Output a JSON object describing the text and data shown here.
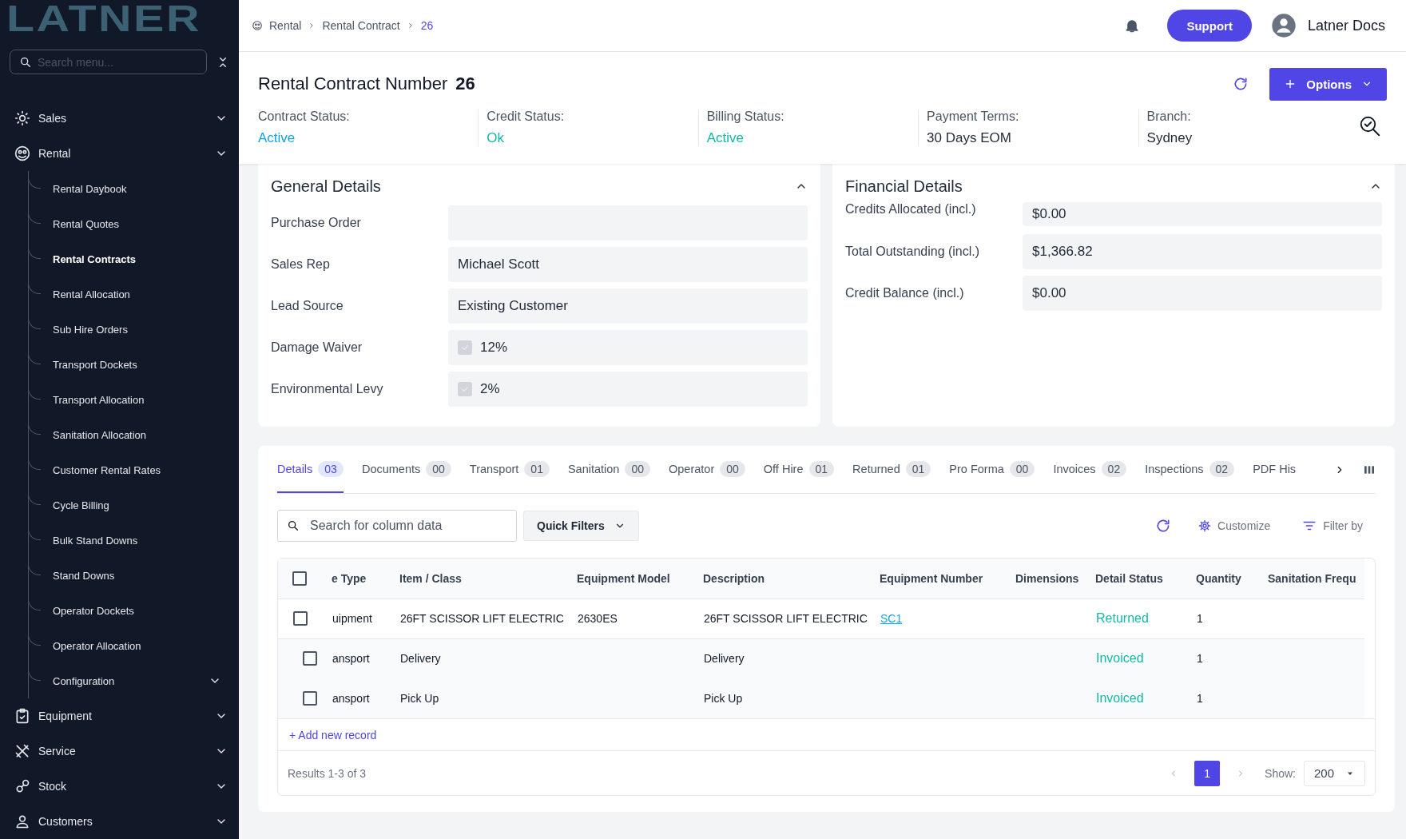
{
  "sidebar": {
    "logo": "LATNER",
    "search": {
      "placeholder": "Search menu..."
    },
    "items": [
      {
        "label": "Sales"
      },
      {
        "label": "Rental",
        "children": [
          {
            "label": "Rental Daybook",
            "kind": "link",
            "selected": false
          },
          {
            "label": "Rental Quotes",
            "kind": "link",
            "selected": false
          },
          {
            "label": "Rental Contracts",
            "kind": "link",
            "selected": true
          },
          {
            "label": "Rental Allocation",
            "kind": "link",
            "selected": false
          },
          {
            "label": "Sub Hire Orders",
            "kind": "link",
            "selected": false
          },
          {
            "label": "Transport Dockets",
            "kind": "link",
            "selected": false
          },
          {
            "label": "Transport Allocation",
            "kind": "link",
            "selected": false
          },
          {
            "label": "Sanitation Allocation",
            "kind": "link",
            "selected": false
          },
          {
            "label": "Customer Rental Rates",
            "kind": "link",
            "selected": false
          },
          {
            "label": "Cycle Billing",
            "kind": "link",
            "selected": false
          },
          {
            "label": "Bulk Stand Downs",
            "kind": "link",
            "selected": false
          },
          {
            "label": "Stand Downs",
            "kind": "link",
            "selected": false
          },
          {
            "label": "Operator Dockets",
            "kind": "link",
            "selected": false
          },
          {
            "label": "Operator Allocation",
            "kind": "link",
            "selected": false
          },
          {
            "label": "Configuration",
            "kind": "group",
            "selected": false
          }
        ]
      },
      {
        "label": "Equipment"
      },
      {
        "label": "Service"
      },
      {
        "label": "Stock"
      },
      {
        "label": "Customers"
      }
    ]
  },
  "topbar": {
    "breadcrumb": [
      {
        "label": "Rental",
        "current": false
      },
      {
        "label": "Rental Contract",
        "current": false
      },
      {
        "label": "26",
        "current": true
      }
    ],
    "support_button": "Support",
    "user_name": "Latner Docs"
  },
  "header": {
    "title": "Rental Contract Number",
    "number": "26",
    "options_button": "Options",
    "statuses": [
      {
        "label": "Contract Status:",
        "value": "Active",
        "color": "#0ea5e9"
      },
      {
        "label": "Credit Status:",
        "value": "Ok",
        "color": "#14b8a6"
      },
      {
        "label": "Billing Status:",
        "value": "Active",
        "color": "#14b8a6"
      },
      {
        "label": "Payment Terms:",
        "value": "30 Days EOM",
        "color": "#1f2937"
      },
      {
        "label": "Branch:",
        "value": "Sydney",
        "color": "#1f2937"
      }
    ]
  },
  "general_details": {
    "title": "General Details",
    "expanded": true,
    "fields": [
      {
        "label": "Purchase Order",
        "kind": "text"
      },
      {
        "label": "Sales Rep",
        "kind": "text",
        "value": "Michael Scott"
      },
      {
        "label": "Lead Source",
        "kind": "text",
        "value": "Existing Customer"
      },
      {
        "label": "Damage Waiver",
        "kind": "check",
        "checked": true,
        "value": "12%"
      },
      {
        "label": "Environmental Levy",
        "kind": "check",
        "checked": true,
        "value": "2%"
      }
    ]
  },
  "financial_details": {
    "title": "Financial Details",
    "expanded": true,
    "fields": [
      {
        "label": "Credits Allocated (incl.)",
        "value": "$0.00"
      },
      {
        "label": "Total Outstanding (incl.)",
        "value": "$1,366.82"
      },
      {
        "label": "Credit Balance (incl.)",
        "value": "$0.00"
      }
    ]
  },
  "tabs": [
    {
      "label": "Details",
      "count": "03",
      "selected": true
    },
    {
      "label": "Documents",
      "count": "00",
      "selected": false
    },
    {
      "label": "Transport",
      "count": "01",
      "selected": false
    },
    {
      "label": "Sanitation",
      "count": "00",
      "selected": false
    },
    {
      "label": "Operator",
      "count": "00",
      "selected": false
    },
    {
      "label": "Off Hire",
      "count": "01",
      "selected": false
    },
    {
      "label": "Returned",
      "count": "01",
      "selected": false
    },
    {
      "label": "Pro Forma",
      "count": "00",
      "selected": false
    },
    {
      "label": "Invoices",
      "count": "02",
      "selected": false
    },
    {
      "label": "Inspections",
      "count": "02",
      "selected": false
    },
    {
      "label": "PDF His",
      "selected": false
    }
  ],
  "toolbar": {
    "search": {
      "placeholder": "Search for column data"
    },
    "quick_filters": "Quick Filters",
    "customize": "Customize",
    "filter_by": "Filter by"
  },
  "table": {
    "all_checked": false,
    "columns": [
      "e Type",
      "Item / Class",
      "Equipment Model",
      "Description",
      "Equipment Number",
      "Dimensions",
      "Detail Status",
      "Quantity",
      "Sanitation Frequ"
    ],
    "rows": [
      {
        "kind": "item",
        "checked": false,
        "type": "uipment",
        "item": "26FT SCISSOR LIFT ELECTRIC",
        "model": "2630ES",
        "description": "26FT SCISSOR LIFT ELECTRIC",
        "equipment_number": "SC1",
        "status": "Returned",
        "quantity": "1"
      },
      {
        "kind": "sub",
        "checked": false,
        "type": "ansport",
        "item": "Delivery",
        "description": "Delivery",
        "status": "Invoiced",
        "quantity": "1"
      },
      {
        "kind": "sub",
        "checked": false,
        "type": "ansport",
        "item": "Pick Up",
        "description": "Pick Up",
        "status": "Invoiced",
        "quantity": "1"
      }
    ],
    "add_record": "+ Add new record",
    "results": "Results 1-3 of 3",
    "pages": [
      {
        "label": "1",
        "selected": true
      }
    ],
    "show_label": "Show:",
    "page_size": "200"
  }
}
